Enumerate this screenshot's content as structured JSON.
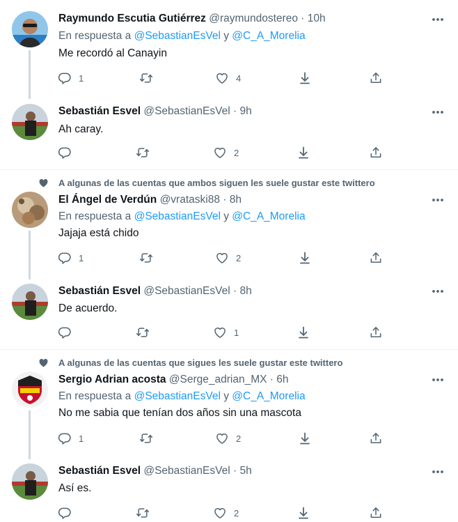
{
  "reply_prefix": "En respuesta a",
  "reply_joiner": "y",
  "dot": "·",
  "colors": {
    "accent": "#1d9bf0",
    "muted": "#536471",
    "text": "#0f1419",
    "thread_line": "#cfd9de"
  },
  "icons": {
    "reply": "speech-bubble",
    "retweet": "retweet-arrows",
    "like": "heart",
    "share": "share-arrow",
    "more": "ellipsis",
    "context": "heart-filled"
  },
  "tweets": [
    {
      "name": "Raymundo Escutia Gutiérrez",
      "handle": "@raymundostereo",
      "time": "10h",
      "reply_to": [
        "@SebastianEsVel",
        "@C_A_Morelia"
      ],
      "text": "Me recordó al Canayin",
      "replies": "1",
      "retweets": "",
      "likes": "4"
    },
    {
      "name": "Sebastián Esvel",
      "handle": "@SebastianEsVel",
      "time": "9h",
      "text": "Ah caray.",
      "replies": "",
      "retweets": "",
      "likes": "2"
    },
    {
      "context": "A algunas de las cuentas que ambos siguen les suele gustar este twittero",
      "name": "El Ángel de Verdún",
      "handle": "@vrataski88",
      "time": "8h",
      "reply_to": [
        "@SebastianEsVel",
        "@C_A_Morelia"
      ],
      "text": "Jajaja está chido",
      "replies": "1",
      "retweets": "",
      "likes": "2"
    },
    {
      "name": "Sebastián Esvel",
      "handle": "@SebastianEsVel",
      "time": "8h",
      "text": "De acuerdo.",
      "replies": "",
      "retweets": "",
      "likes": "1"
    },
    {
      "context": "A algunas de las cuentas que sigues les suele gustar este twittero",
      "name": "Sergio Adrian acosta",
      "handle": "@Serge_adrian_MX",
      "time": "6h",
      "reply_to": [
        "@SebastianEsVel",
        "@C_A_Morelia"
      ],
      "text": "No me sabia que tenían dos años sin una mascota",
      "replies": "1",
      "retweets": "",
      "likes": "2"
    },
    {
      "name": "Sebastián Esvel",
      "handle": "@SebastianEsVel",
      "time": "5h",
      "text": "Así es.",
      "replies": "",
      "retweets": "",
      "likes": "2"
    }
  ]
}
